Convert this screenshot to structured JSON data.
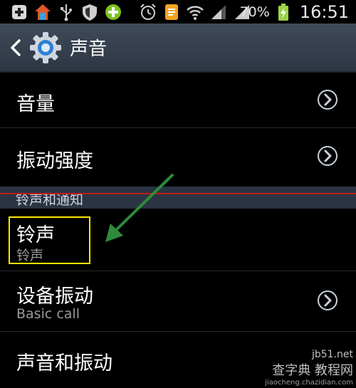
{
  "status_bar": {
    "battery_percent": "70%",
    "time": "16:51",
    "icons": [
      "plus-square-icon",
      "home-app-icon",
      "usb-icon",
      "shield-icon",
      "green-plus-icon",
      "alarm-icon",
      "document-icon",
      "wifi-icon",
      "signal-icon",
      "battery-charging-icon"
    ]
  },
  "action_bar": {
    "title": "声音",
    "back_icon": "chevron-left-icon",
    "app_icon": "gear-icon"
  },
  "items": [
    {
      "title": "音量",
      "subtitle": ""
    },
    {
      "title": "振动强度",
      "subtitle": ""
    },
    {
      "title": "铃声",
      "subtitle": "铃声"
    },
    {
      "title": "设备振动",
      "subtitle": "Basic call"
    },
    {
      "title": "声音和振动",
      "subtitle": ""
    }
  ],
  "section": {
    "label": "铃声和通知"
  },
  "watermark": {
    "line1": "jb51.net",
    "line2": "查字典 教程网",
    "line3": "jiaocheng.chazidian.com"
  },
  "colors": {
    "highlight": "#ffe800",
    "arrow": "#2e8b3a",
    "action_bar": "#3a4452",
    "section_bg": "#2a3442",
    "red_line": "#c21b1b"
  }
}
